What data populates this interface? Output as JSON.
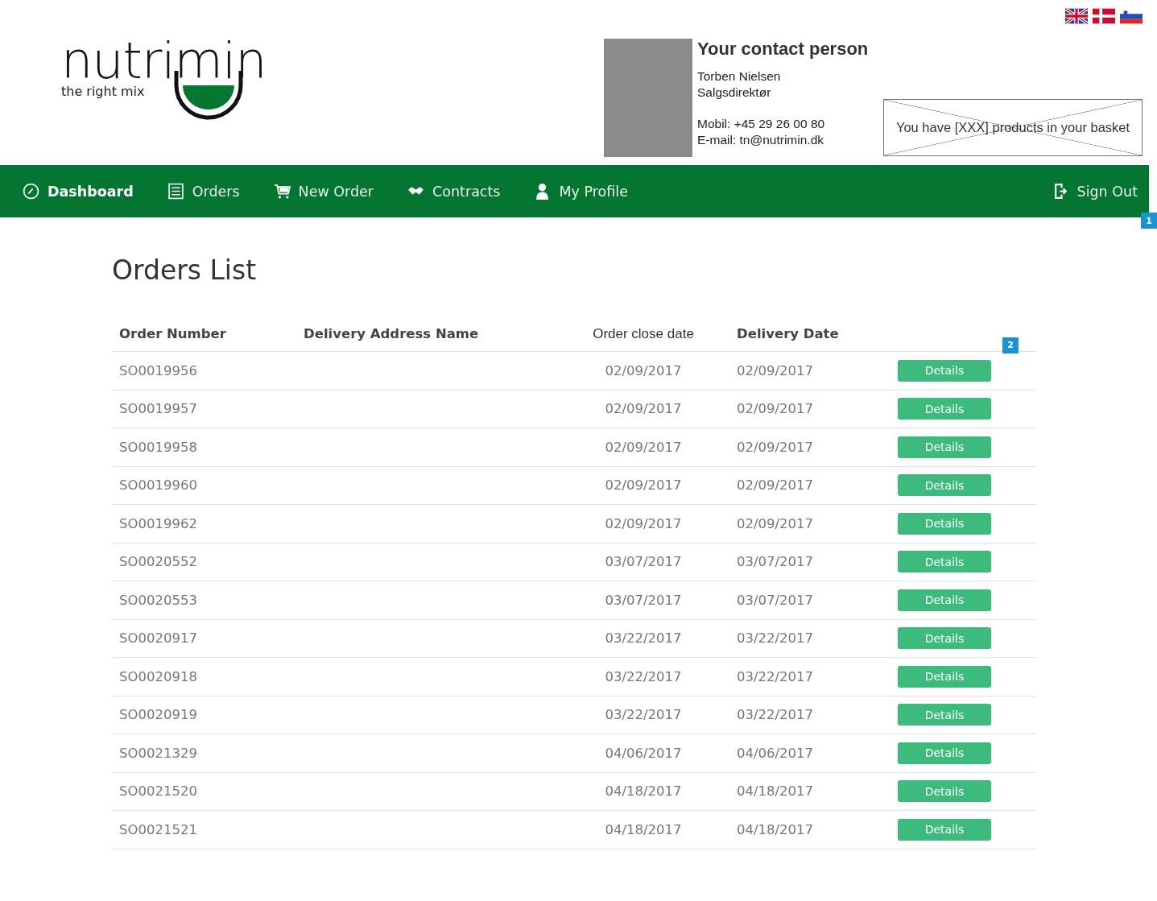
{
  "logo": {
    "name": "nutrimin",
    "tagline": "the right mix"
  },
  "languages": [
    {
      "kind": "uk"
    },
    {
      "kind": "dk"
    },
    {
      "kind": "si"
    }
  ],
  "contact": {
    "heading": "Your contact person",
    "name": "Torben Nielsen",
    "title": "Salgsdirektør",
    "phone": "Mobil: +45 29 26 00 80",
    "email": "E-mail: tn@nutrimin.dk"
  },
  "basket": {
    "text": "You have [XXX] products in your basket"
  },
  "nav": [
    {
      "label": "Dashboard",
      "kind": "dashboard",
      "selected": true
    },
    {
      "label": "Orders",
      "kind": "list",
      "selected": false
    },
    {
      "label": "New Order",
      "kind": "cart",
      "selected": false
    },
    {
      "label": "Contracts",
      "kind": "handshake",
      "selected": false
    },
    {
      "label": "My Profile",
      "kind": "user",
      "selected": false
    }
  ],
  "sign_out": "Sign Out",
  "markers": [
    "1",
    "2"
  ],
  "page_title": "Orders List",
  "table": {
    "columns": [
      "Order Number",
      "Delivery Address Name",
      "Order close date",
      "Delivery Date"
    ],
    "rows": [
      {
        "order": "SO0019956",
        "close": "02/09/2017",
        "delivery": "02/09/2017",
        "action": "Details"
      },
      {
        "order": "SO0019957",
        "close": "02/09/2017",
        "delivery": "02/09/2017",
        "action": "Details"
      },
      {
        "order": "SO0019958",
        "close": "02/09/2017",
        "delivery": "02/09/2017",
        "action": "Details"
      },
      {
        "order": "SO0019960",
        "close": "02/09/2017",
        "delivery": "02/09/2017",
        "action": "Details"
      },
      {
        "order": "SO0019962",
        "close": "02/09/2017",
        "delivery": "02/09/2017",
        "action": "Details"
      },
      {
        "order": "SO0020552",
        "close": "03/07/2017",
        "delivery": "03/07/2017",
        "action": "Details"
      },
      {
        "order": "SO0020553",
        "close": "03/07/2017",
        "delivery": "03/07/2017",
        "action": "Details"
      },
      {
        "order": "SO0020917",
        "close": "03/22/2017",
        "delivery": "03/22/2017",
        "action": "Details"
      },
      {
        "order": "SO0020918",
        "close": "03/22/2017",
        "delivery": "03/22/2017",
        "action": "Details"
      },
      {
        "order": "SO0020919",
        "close": "03/22/2017",
        "delivery": "03/22/2017",
        "action": "Details"
      },
      {
        "order": "SO0021329",
        "close": "04/06/2017",
        "delivery": "04/06/2017",
        "action": "Details"
      },
      {
        "order": "SO0021520",
        "close": "04/18/2017",
        "delivery": "04/18/2017",
        "action": "Details"
      },
      {
        "order": "SO0021521",
        "close": "04/18/2017",
        "delivery": "04/18/2017",
        "action": "Details"
      }
    ]
  }
}
